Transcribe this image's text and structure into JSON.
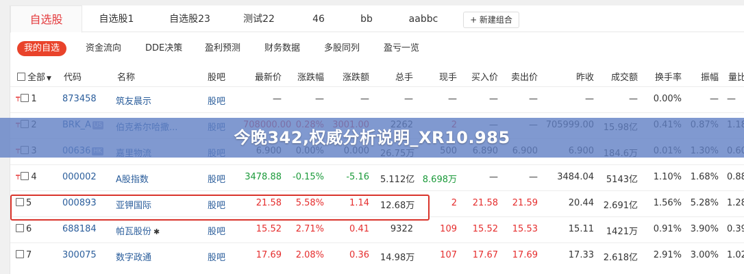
{
  "tabs": [
    {
      "label": "自选股",
      "active": true
    },
    {
      "label": "自选股1"
    },
    {
      "label": "自选股23"
    },
    {
      "label": "测试22"
    },
    {
      "label": "46"
    },
    {
      "label": "bb"
    },
    {
      "label": "aabbc"
    }
  ],
  "new_group_label": "+ 新建组合",
  "subtabs": [
    "我的自选",
    "资金流向",
    "DDE决策",
    "盈利预测",
    "财务数据",
    "多股同列",
    "盈亏一览"
  ],
  "columns": {
    "select_all": "全部",
    "code": "代码",
    "name": "名称",
    "forum": "股吧",
    "price": "最新价",
    "change_pct": "涨跌幅",
    "change": "涨跌额",
    "volume": "总手",
    "current": "现手",
    "bid": "买入价",
    "ask": "卖出价",
    "prev_close": "昨收",
    "turnover_amt": "成交额",
    "turnover_rate": "换手率",
    "amplitude": "振幅",
    "volume_ratio": "量比"
  },
  "rows": [
    {
      "idx": "1",
      "pinned": true,
      "code": "873458",
      "name": "筑友晨示",
      "forum": "股吧",
      "price": "—",
      "change_pct": "—",
      "change": "—",
      "volume": "—",
      "current": "—",
      "bid": "—",
      "ask": "—",
      "prev_close": "—",
      "turnover_amt": "—",
      "turnover_rate": "0.00%",
      "amplitude": "—",
      "volume_ratio": "—"
    },
    {
      "idx": "2",
      "pinned": true,
      "code": "BRK_A",
      "badge": "US",
      "name": "伯克希尔哈撒...",
      "forum": "股吧",
      "price": "708000.00",
      "change_pct": "0.28%",
      "change": "3001.00",
      "volume": "2262",
      "current": "2",
      "bid": "—",
      "ask": "—",
      "prev_close": "705999.00",
      "turnover_amt": "15.98亿",
      "turnover_rate": "0.41%",
      "amplitude": "0.87%",
      "volume_ratio": "1.18"
    },
    {
      "idx": "3",
      "pinned": true,
      "code": "00636",
      "badge": "HK",
      "name": "嘉里物流",
      "forum": "股吧",
      "price": "6.900",
      "change_pct": "0.00%",
      "change": "0.000",
      "volume": "26.75万",
      "current": "500",
      "bid": "6.890",
      "ask": "6.900",
      "prev_close": "6.900",
      "turnover_amt": "184.6万",
      "turnover_rate": "0.01%",
      "amplitude": "1.30%",
      "volume_ratio": "0.60"
    },
    {
      "idx": "4",
      "pinned": true,
      "code": "000002",
      "name": "A股指数",
      "forum": "股吧",
      "price": "3478.88",
      "change_pct": "-0.15%",
      "change": "-5.16",
      "volume": "5.112亿",
      "current": "8.698万",
      "bid": "—",
      "ask": "—",
      "prev_close": "3484.04",
      "turnover_amt": "5143亿",
      "turnover_rate": "1.10%",
      "amplitude": "1.68%",
      "volume_ratio": "0.88"
    },
    {
      "idx": "5",
      "pinned": false,
      "code": "000893",
      "name": "亚钾国际",
      "forum": "股吧",
      "price": "21.58",
      "change_pct": "5.58%",
      "change": "1.14",
      "volume": "12.68万",
      "current": "2",
      "bid": "21.58",
      "ask": "21.59",
      "prev_close": "20.44",
      "turnover_amt": "2.691亿",
      "turnover_rate": "1.56%",
      "amplitude": "5.28%",
      "volume_ratio": "1.28"
    },
    {
      "idx": "6",
      "pinned": false,
      "code": "688184",
      "name": "帕瓦股份",
      "star": "✱",
      "forum": "股吧",
      "price": "15.52",
      "change_pct": "2.71%",
      "change": "0.41",
      "volume": "9322",
      "current": "109",
      "bid": "15.52",
      "ask": "15.53",
      "prev_close": "15.11",
      "turnover_amt": "1421万",
      "turnover_rate": "0.91%",
      "amplitude": "3.90%",
      "volume_ratio": "0.39"
    },
    {
      "idx": "7",
      "pinned": false,
      "code": "300075",
      "name": "数字政通",
      "forum": "股吧",
      "price": "17.69",
      "change_pct": "2.08%",
      "change": "0.36",
      "volume": "14.98万",
      "current": "107",
      "bid": "17.67",
      "ask": "17.69",
      "prev_close": "17.33",
      "turnover_amt": "2.618亿",
      "turnover_rate": "2.91%",
      "amplitude": "3.00%",
      "volume_ratio": "1.02"
    }
  ],
  "banner": "今晚342,权威分析说明_XR10.985",
  "colors": {
    "up": "#e52d2d",
    "down": "#1b9a3a",
    "link": "#2a5d9b",
    "accent": "#e9432b"
  }
}
